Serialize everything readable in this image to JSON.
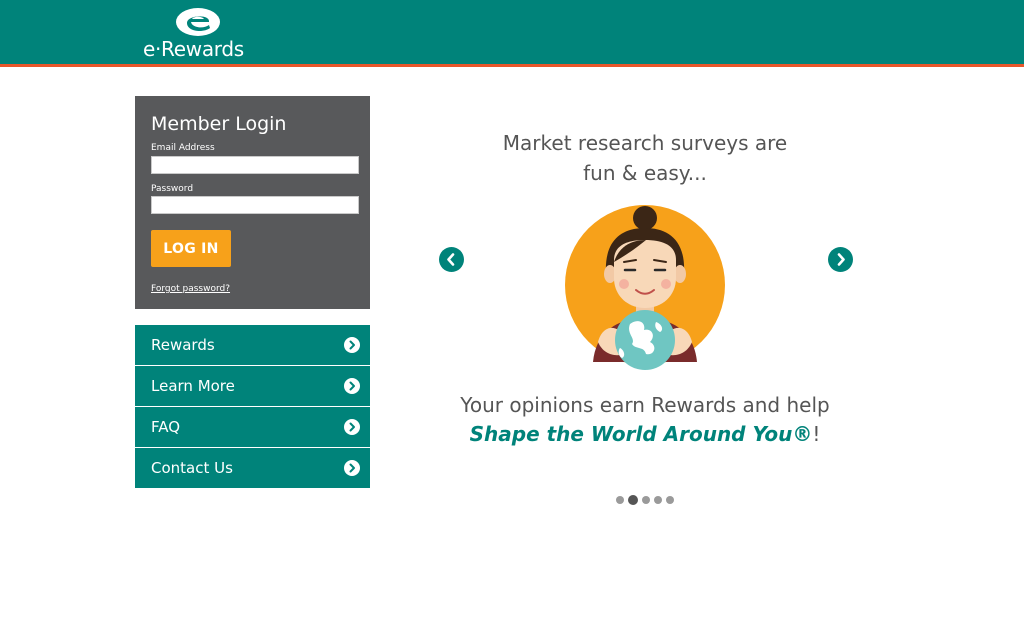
{
  "brand": {
    "name": "e·Rewards",
    "color": "#00837a",
    "accent_rule": "#e8572b"
  },
  "login": {
    "title": "Member Login",
    "email_label": "Email Address",
    "email_value": "",
    "password_label": "Password",
    "password_value": "",
    "button_label": "LOG IN",
    "button_color": "#f7a11a",
    "forgot_label": "Forgot password?"
  },
  "nav": {
    "items": [
      {
        "label": "Rewards",
        "icon": "chevron-right-icon"
      },
      {
        "label": "Learn More",
        "icon": "chevron-right-icon"
      },
      {
        "label": "FAQ",
        "icon": "chevron-right-icon"
      },
      {
        "label": "Contact Us",
        "icon": "chevron-right-icon"
      }
    ]
  },
  "carousel": {
    "heading_line1": "Market research surveys are",
    "heading_line2": "fun & easy...",
    "caption_line1": "Your opinions earn Rewards and help",
    "caption_accent": "Shape the World Around You®",
    "caption_suffix": "!",
    "slide_count": 5,
    "active_slide": 2,
    "prev_icon": "chevron-left-icon",
    "next_icon": "chevron-right-icon"
  }
}
